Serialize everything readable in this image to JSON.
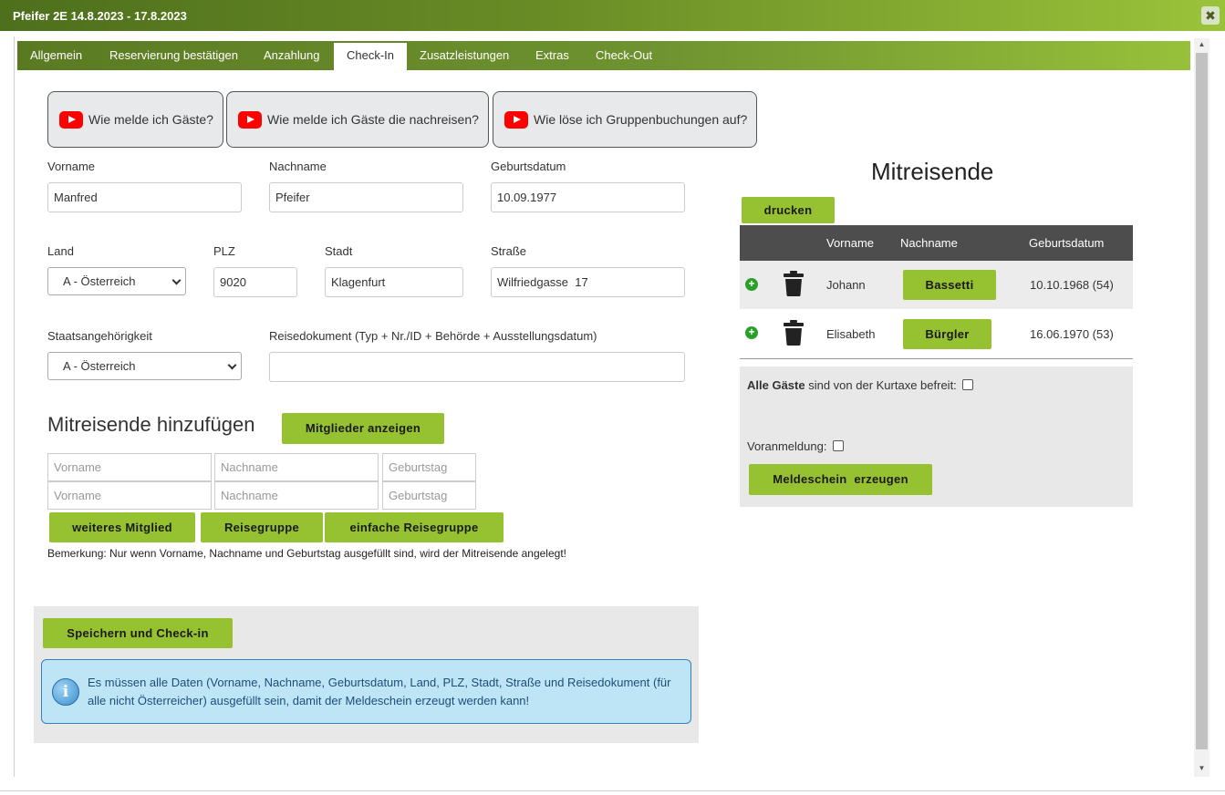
{
  "window": {
    "title": "Pfeifer 2E 14.8.2023 - 17.8.2023",
    "close_glyph": "✖"
  },
  "tabs": [
    {
      "label": "Allgemein"
    },
    {
      "label": "Reservierung bestätigen"
    },
    {
      "label": "Anzahlung"
    },
    {
      "label": "Check-In"
    },
    {
      "label": "Zusatzleistungen"
    },
    {
      "label": "Extras"
    },
    {
      "label": "Check-Out"
    }
  ],
  "active_tab": "Check-In",
  "video_buttons": [
    {
      "label": "Wie melde ich Gäste?"
    },
    {
      "label": "Wie melde ich Gäste die nachreisen?"
    },
    {
      "label": "Wie löse ich Gruppenbuchungen auf?"
    }
  ],
  "form": {
    "vorname": {
      "label": "Vorname",
      "value": "Manfred"
    },
    "nachname": {
      "label": "Nachname",
      "value": "Pfeifer"
    },
    "geburtsdatum": {
      "label": "Geburtsdatum",
      "value": "10.09.1977"
    },
    "land": {
      "label": "Land",
      "value": "A - Österreich"
    },
    "plz": {
      "label": "PLZ",
      "value": "9020"
    },
    "stadt": {
      "label": "Stadt",
      "value": "Klagenfurt"
    },
    "strasse": {
      "label": "Straße",
      "value": "Wilfriedgasse  17"
    },
    "staat": {
      "label": "Staatsangehörigkeit",
      "value": "A - Österreich"
    },
    "reisedokument": {
      "label": "Reisedokument (Typ + Nr./ID + Behörde + Ausstellungsdatum)",
      "value": ""
    }
  },
  "add_companions": {
    "heading": "Mitreisende hinzufügen",
    "show_members_button": "Mitglieder anzeigen",
    "rows": [
      {
        "vorname_placeholder": "Vorname",
        "nachname_placeholder": "Nachname",
        "geburtstag_placeholder": "Geburtstag"
      },
      {
        "vorname_placeholder": "Vorname",
        "nachname_placeholder": "Nachname",
        "geburtstag_placeholder": "Geburtstag"
      }
    ],
    "buttons": {
      "more": "weiteres Mitglied",
      "group": "Reisegruppe",
      "simple_group": "einfache Reisegruppe"
    },
    "note": "Bemerkung: Nur wenn Vorname, Nachname und Geburtstag ausgefüllt sind, wird der Mitreisende angelegt!"
  },
  "save": {
    "button": "Speichern und Check-in",
    "info": "Es müssen alle Daten (Vorname, Nachname, Geburtsdatum, Land, PLZ, Stadt, Straße und Reisedokument (für alle nicht Österreicher) ausgefüllt sein, damit der Meldeschein erzeugt werden kann!",
    "info_icon": "i"
  },
  "companions": {
    "heading": "Mitreisende",
    "print_button": "drucken",
    "columns": {
      "vorname": "Vorname",
      "nachname": "Nachname",
      "geburtsdatum": "Geburtsdatum"
    },
    "rows": [
      {
        "vorname": "Johann",
        "nachname": "Bassetti",
        "geburtsdatum": "10.10.1968 (54)"
      },
      {
        "vorname": "Elisabeth",
        "nachname": "Bürgler",
        "geburtsdatum": "16.06.1970 (53)"
      }
    ],
    "row_icons": [
      "plus-circle-icon",
      "trash-icon"
    ],
    "plus_glyph": "+"
  },
  "options": {
    "kurtaxe_bold": "Alle Gäste",
    "kurtaxe_rest": " sind von der Kurtaxe befreit:",
    "kurtaxe_checked": false,
    "voranmeldung": "Voranmeldung:",
    "voranmeldung_checked": false,
    "meldeschein_button": "Meldeschein  erzeugen"
  },
  "colors": {
    "accent_green": "#96c131",
    "header_dark_green": "#4e6f1c",
    "table_header": "#4d4d4d",
    "info_background": "#bee5f6",
    "youtube_red": "#ff0000"
  }
}
